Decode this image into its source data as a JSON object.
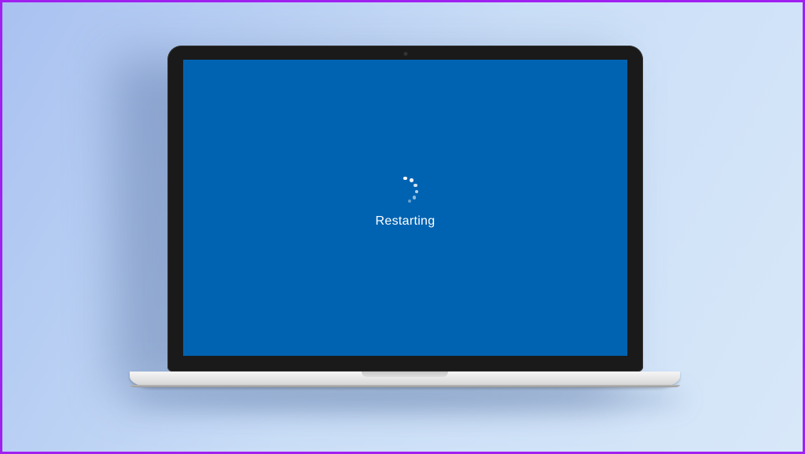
{
  "screen": {
    "status_text": "Restarting",
    "background_color": "#0063b1",
    "text_color": "#ffffff"
  }
}
